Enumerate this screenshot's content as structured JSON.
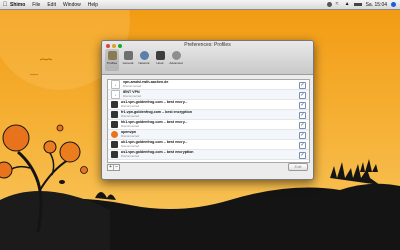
{
  "menubar": {
    "app_name": "Shimo",
    "items": [
      "File",
      "Edit",
      "Window",
      "Help"
    ],
    "clock": "Sa. 15:04",
    "icons": [
      "apple-icon",
      "shimo-status-icon",
      "wifi-icon",
      "volume-icon",
      "battery-icon",
      "spotlight-icon"
    ]
  },
  "window": {
    "title": "Preferences: Profiles",
    "toolbar": [
      {
        "label": "Profiles",
        "icon": "profiles-icon",
        "active": true
      },
      {
        "label": "General",
        "icon": "general-icon",
        "active": false
      },
      {
        "label": "Network",
        "icon": "network-icon",
        "active": false
      },
      {
        "label": "Hook",
        "icon": "hook-icon",
        "active": false
      },
      {
        "label": "Advanced",
        "icon": "advanced-icon",
        "active": false
      }
    ],
    "profiles": [
      {
        "name": "vpn-amdsl.rwth-aachen.de",
        "status": "Disconnected",
        "icon": "cisco-icon",
        "checked": true
      },
      {
        "name": "IENT VPN",
        "status": "Disconnected",
        "icon": "cisco-icon",
        "checked": true
      },
      {
        "name": "us1.vpn.goldenfrog.com – best encry...",
        "status": "Disconnected",
        "icon": "vyprvpn-icon",
        "checked": true
      },
      {
        "name": "fr1.vpn.goldenfrog.com – best encryption",
        "status": "Disconnected",
        "icon": "vyprvpn-icon",
        "checked": true
      },
      {
        "name": "hk1.vpn.goldenfrog.com – best encry...",
        "status": "Disconnected",
        "icon": "vyprvpn-icon",
        "checked": true
      },
      {
        "name": "openvpn",
        "status": "Disconnected",
        "icon": "openvpn-icon",
        "checked": true
      },
      {
        "name": "uk1.vpn.goldenfrog.com – best encry...",
        "status": "Disconnected",
        "icon": "vyprvpn-icon",
        "checked": true
      },
      {
        "name": "us1.vpn.goldenfrog.com – best encryption",
        "status": "Disconnected",
        "icon": "vyprvpn-icon",
        "checked": true
      }
    ],
    "add_label": "+",
    "remove_label": "–",
    "edit_label": "Edit"
  },
  "colors": {
    "sky_top": "#f7a21c",
    "sky_bottom": "#f8c95a",
    "silhouette": "#141414",
    "tree_leaves": "#ec7d1e"
  }
}
